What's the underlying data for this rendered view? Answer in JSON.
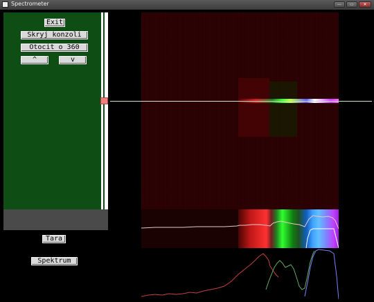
{
  "window": {
    "title": "Spectrometer",
    "buttons": {
      "minimize": "—",
      "maximize": "▭",
      "close": "✕"
    }
  },
  "controls": {
    "exit": "Exit",
    "hide_console": "Skryj konzoli",
    "rotate": "Otocit o 360",
    "up": "^",
    "down": "v",
    "tara": "Tara",
    "spectrum": "Spektrum"
  },
  "colors": {
    "panel_green": "#0e4d14",
    "panel_gray": "#4a4a4a",
    "slider_handle": "#f08080",
    "scan_line": "#cfe6cf",
    "background": "#000000"
  }
}
